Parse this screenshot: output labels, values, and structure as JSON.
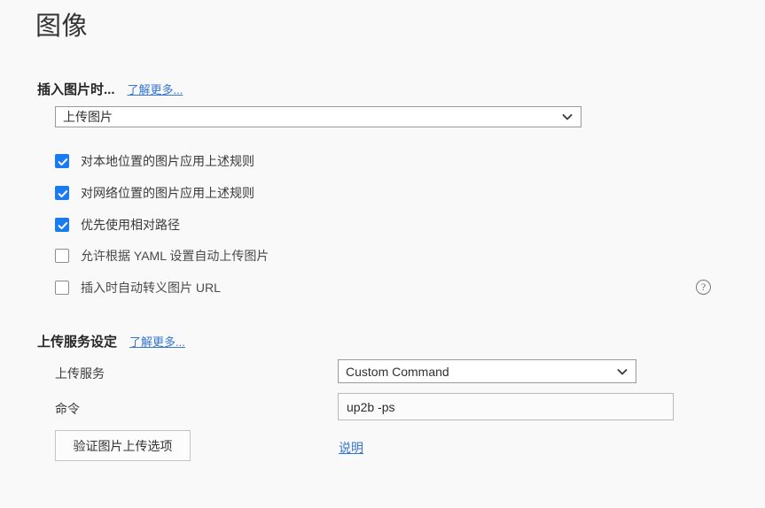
{
  "page": {
    "title": "图像",
    "background_color": "#f9f9f9",
    "accent_color": "#1a7af0",
    "link_color": "#3575d3"
  },
  "sections": {
    "insert": {
      "header": "插入图片时...",
      "learn_more": "了解更多...",
      "behavior_select": {
        "value": "上传图片",
        "icon": "chevron-down-icon"
      },
      "checkboxes": [
        {
          "label": "对本地位置的图片应用上述规则",
          "checked": true
        },
        {
          "label": "对网络位置的图片应用上述规则",
          "checked": true
        },
        {
          "label": "优先使用相对路径",
          "checked": true
        },
        {
          "label": "允许根据 YAML 设置自动上传图片",
          "checked": false
        },
        {
          "label": "插入时自动转义图片 URL",
          "checked": false
        }
      ],
      "help_icon": {
        "glyph": "?",
        "name": "help-circle-icon"
      }
    },
    "upload": {
      "header": "上传服务设定",
      "learn_more": "了解更多...",
      "service": {
        "label": "上传服务",
        "value": "Custom Command",
        "icon": "chevron-down-icon"
      },
      "command": {
        "label": "命令",
        "value": "up2b -ps",
        "placeholder": ""
      },
      "verify_button": "验证图片上传选项",
      "help_link": "说明"
    }
  }
}
